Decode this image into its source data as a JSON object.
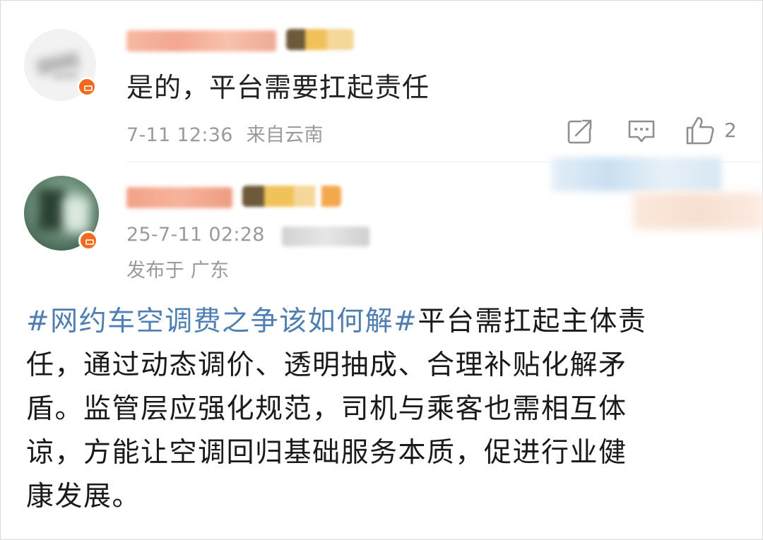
{
  "comment_1": {
    "text": "是的，平台需要扛起责任",
    "time": "7-11 12:36",
    "source": "来自云南",
    "actions": {
      "share_icon": "share-icon",
      "comment_icon": "comment-icon",
      "like_icon": "thumbs-up-icon",
      "like_count": "2"
    }
  },
  "post_2": {
    "time": "25-7-11 02:28",
    "location": "发布于 广东",
    "body": {
      "hashtag": "#网约车空调费之争该如何解#",
      "line_1_rest": "平台需扛起主体责",
      "line_2": "任，通过动态调价、透明抽成、合理补贴化解矛",
      "line_3": "盾。监管层应强化规范，司机与乘客也需相互体",
      "line_4": "谅，方能让空调回归基础服务本质，促进行业健",
      "line_5": "康发展。"
    }
  },
  "colors": {
    "hashtag": "#4f7fb2",
    "meta_text": "#9a9a9a",
    "badge": "#f26a21"
  }
}
